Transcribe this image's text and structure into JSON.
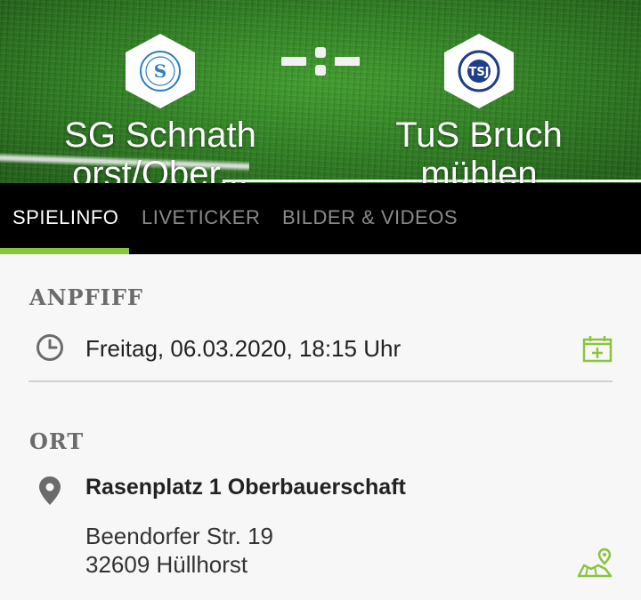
{
  "header": {
    "home_team": {
      "name_line1": "SG Schnath",
      "name_line2": "orst/Ober..."
    },
    "guest_team": {
      "name_line1": "TuS Bruch",
      "name_line2": "mühlen"
    },
    "score": "-:-"
  },
  "tabs": [
    {
      "label": "SPIELINFO",
      "active": true
    },
    {
      "label": "LIVETICKER",
      "active": false
    },
    {
      "label": "BILDER & VIDEOS",
      "active": false
    }
  ],
  "kickoff": {
    "heading": "ANPFIFF",
    "datetime": "Freitag, 06.03.2020, 18:15 Uhr",
    "icon": "clock-icon",
    "action_icon": "calendar-add-icon"
  },
  "location": {
    "heading": "ORT",
    "venue": "Rasenplatz 1 Oberbauerschaft",
    "street": "Beendorfer Str. 19",
    "city": "32609 Hüllhorst",
    "icon": "location-pin-icon",
    "action_icon": "map-icon"
  },
  "colors": {
    "accent": "#8ac43f",
    "tab_bar": "#000000",
    "heading": "#6b6b6b"
  }
}
